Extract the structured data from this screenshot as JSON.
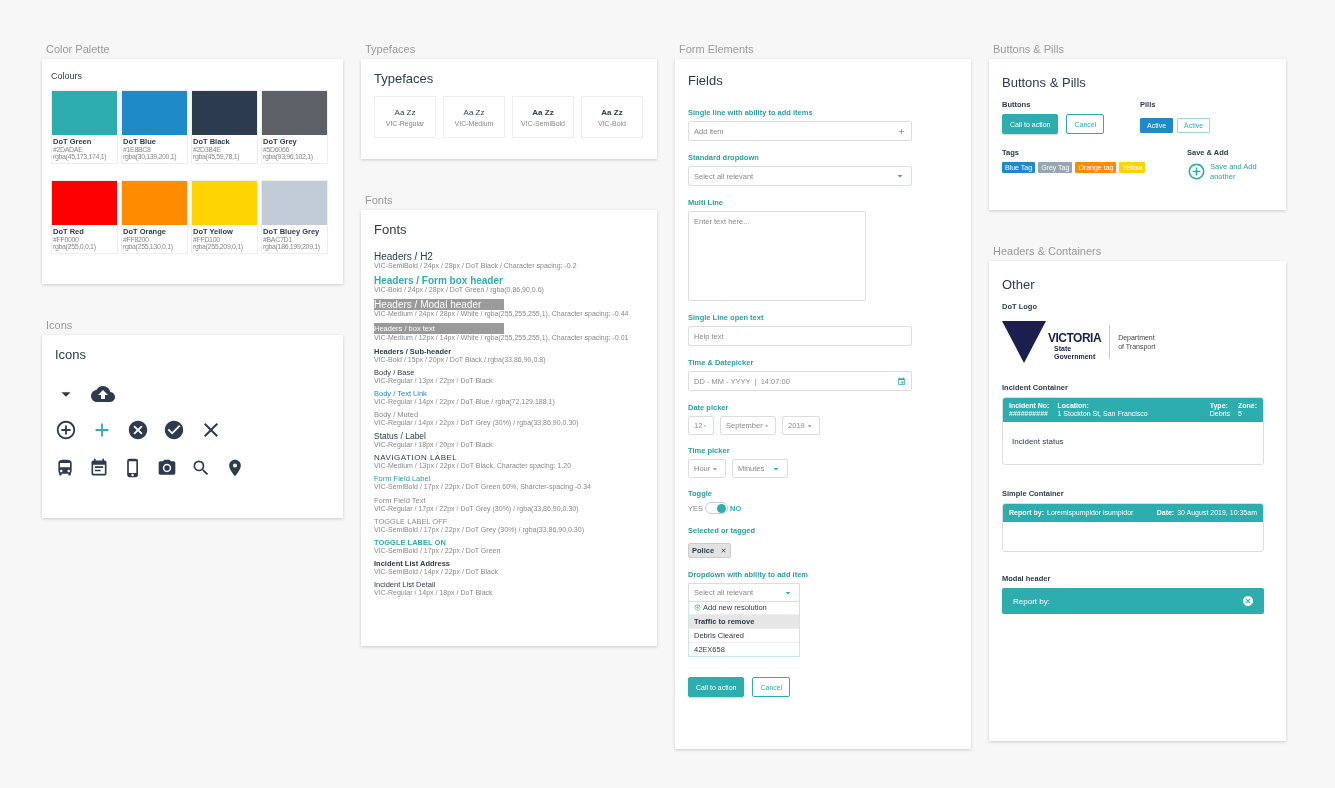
{
  "palette": {
    "section": "Color Palette",
    "title": "Colours",
    "swatches": [
      {
        "name": "DoT Green",
        "hex": "#2DADAE",
        "rgba": "rgba(45,173,174,1)",
        "color": "#2dadae"
      },
      {
        "name": "DoT Blue",
        "hex": "#1E8BC8",
        "rgba": "rgba(30,139,200,1)",
        "color": "#1e8bc8"
      },
      {
        "name": "DoT Black",
        "hex": "#2D3B4E",
        "rgba": "rgba(45,59,78,1)",
        "color": "#2d3b4e"
      },
      {
        "name": "DoT Grey",
        "hex": "#5D6066",
        "rgba": "rgba(93,96,102,1)",
        "color": "#5d6066"
      },
      {
        "name": "DoT Red",
        "hex": "#FF0000",
        "rgba": "rgba(255,0,0,1)",
        "color": "#ff0000"
      },
      {
        "name": "DoT Orange",
        "hex": "#FF8200",
        "rgba": "rgba(255,130,0,1)",
        "color": "#ff8b00"
      },
      {
        "name": "DoT Yellow",
        "hex": "#FFD100",
        "rgba": "rgba(255,209,0,1)",
        "color": "#ffd400"
      },
      {
        "name": "DoT Bluey Grey",
        "hex": "#BAC7D1",
        "rgba": "rgba(186,199,209,1)",
        "color": "#c1ccd6"
      }
    ]
  },
  "icons": {
    "section": "Icons",
    "title": "Icons"
  },
  "typefaces": {
    "section": "Typefaces",
    "title": "Typefaces",
    "samples": [
      {
        "sample": "Aa Zz",
        "name": "VIC-Regular",
        "kind": "regular"
      },
      {
        "sample": "Aa Zz",
        "name": "VIC-Medium",
        "kind": "medium"
      },
      {
        "sample": "Aa Zz",
        "name": "VIC-SemiBold",
        "kind": "semibold"
      },
      {
        "sample": "Aa Zz",
        "name": "VIC-Bold",
        "kind": "bold"
      }
    ]
  },
  "fonts": {
    "section": "Fonts",
    "title": "Fonts",
    "styles": [
      {
        "kind": "h2",
        "name": "Headers / H2",
        "spec": "VIC-SemiBold / 24px / 28px / DoT Black / Character spacing: -0.2"
      },
      {
        "kind": "form-header",
        "name": "Headers / Form box header",
        "spec": "VIC-Bold / 24px / 28px / DoT Green / rgba(0,86,90,0.6)"
      },
      {
        "kind": "modal-header",
        "name": "Headers / Modal header",
        "spec": "VIC-Medium / 24px / 28px / White / rgba(255,255,255,1), Character spacing: -0.44"
      },
      {
        "kind": "box-text",
        "name": "Headers / box text",
        "spec": "VIC-Medium / 12px / 14px / White / rgba(255,255,255,1), Character spacing: -0.01"
      },
      {
        "kind": "sub-header",
        "name": "Headers / Sub-header",
        "spec": "VIC-Bold / 15px / 20px / DoT Black / rgba(33,86,90,0.8)"
      },
      {
        "kind": "body",
        "name": "Body / Base",
        "spec": "VIC-Regular / 13px / 22px / DoT Black"
      },
      {
        "kind": "link",
        "name": "Body / Text Link",
        "spec": "VIC-Regular / 14px / 22px / DoT Blue / rgba(72,129,188,1)"
      },
      {
        "kind": "muted",
        "name": "Body / Muted",
        "spec": "VIC-Regular / 14px / 22px / DoT Grey (30%) / rgba(33,86,90,0.30)"
      },
      {
        "kind": "status",
        "name": "Status / Label",
        "spec": "VIC-Regular / 18px / 20px / DoT Black"
      },
      {
        "kind": "nav",
        "name": "NAVIGATION LABEL",
        "spec": "VIC-Medium / 13px / 22px / DoT Black, Character spacing: 1.20"
      },
      {
        "kind": "field-label",
        "name": "Form Field Label",
        "spec": "VIC-SemiBold / 17px / 22px / DoT Green 60%, Sharcter-spacing -0.34"
      },
      {
        "kind": "field-text",
        "name": "Form Field Text",
        "spec": "VIC-Regular / 17px / 22px / DoT Grey (30%) / rgba(33,86,90,0.30)"
      },
      {
        "kind": "toggle-off",
        "name": "TOGGLE LABEL OFF",
        "spec": "VIC-SemiBold / 17px / 22px / DoT Grey (30%) / rgba(33,86,90,0.30)"
      },
      {
        "kind": "toggle-on",
        "name": "TOGGLE LABEL ON",
        "spec": "VIC-SemiBold / 17px / 22px / DoT Green"
      },
      {
        "kind": "address",
        "name": "Incident List Address",
        "spec": "VIC-SemiBold / 14px / 22px / DoT Black"
      },
      {
        "kind": "detail",
        "name": "Incident List Detail",
        "spec": "VIC-Regular / 14px / 18px / DoT Black"
      }
    ]
  },
  "form": {
    "section": "Form Elements",
    "title": "Fields",
    "fields": [
      {
        "kind": "add",
        "label": "Single line with ability to add items",
        "placeholder": "Add item"
      },
      {
        "kind": "dropdown",
        "label": "Standard dropdown",
        "placeholder": "Select all relevant"
      },
      {
        "kind": "multiline",
        "label": "Multi Line",
        "placeholder": "Enter text here..."
      },
      {
        "kind": "text",
        "label": "Single Line open text",
        "placeholder": "Help text"
      },
      {
        "kind": "datetime",
        "label": "Time & Datepicker",
        "placeholder": "DD - MM - YYYY  |  14:07:00"
      },
      {
        "kind": "selects",
        "label": "Date picker",
        "selects": [
          "12",
          "September",
          "2019"
        ]
      },
      {
        "kind": "selects",
        "label": "Time picker",
        "selects": [
          "Hour",
          "Minutes"
        ]
      },
      {
        "kind": "toggle",
        "label": "Toggle",
        "off_label": "YES",
        "on_label": "NO",
        "on": true
      },
      {
        "kind": "tag",
        "label": "Selected or tagged",
        "tag": "Police"
      },
      {
        "kind": "dropdown-add",
        "label": "Dropdown with ability to add item",
        "placeholder": "Select all relevant",
        "add_label": "Add new resolution",
        "options": [
          {
            "label": "Traffic to remove",
            "selected": true
          },
          {
            "label": "Debris Cleared",
            "selected": false
          },
          {
            "label": "42EX658",
            "selected": false
          }
        ]
      }
    ],
    "buttons": [
      {
        "label": "Call to action",
        "kind": "primary"
      },
      {
        "label": "Cancel",
        "kind": "secondary"
      }
    ]
  },
  "buttons_pills": {
    "section": "Buttons & Pills",
    "title": "Buttons & Pills",
    "buttons_label": "Buttons",
    "buttons": [
      {
        "label": "Call to action",
        "kind": "primary"
      },
      {
        "label": "Cancel",
        "kind": "secondary"
      }
    ],
    "pills_label": "Pills",
    "pills": [
      {
        "label": "Active",
        "selected": true
      },
      {
        "label": "Active",
        "selected": false
      }
    ],
    "tags_label": "Tags",
    "tags": [
      {
        "label": "Blue Tag",
        "color": "#1e8bc8"
      },
      {
        "label": "Grey Tag",
        "color": "#98a6b3"
      },
      {
        "label": "Orange tag",
        "color": "#ff8b00"
      },
      {
        "label": "Yellow",
        "color": "#ffd400"
      }
    ],
    "save_label": "Save & Add",
    "save_text": "Save and Add another"
  },
  "containers": {
    "section": "Headers & Containers",
    "title": "Other",
    "logo_label": "DoT Logo",
    "logo": {
      "wordmark": "VICTORIA",
      "line1": "State",
      "line2": "Government",
      "dept1": "Department",
      "dept2": "of Transport"
    },
    "incident_label": "Incident Container",
    "incident_fields": [
      {
        "label": "Incident No:",
        "value": "##########"
      },
      {
        "label": "Location:",
        "value": "1 Stockton St, San Francisco"
      },
      {
        "label": "Type:",
        "value": "Debris"
      },
      {
        "label": "Zone:",
        "value": "5"
      }
    ],
    "incident_status": "Incident status",
    "simple_label": "Simple Container",
    "simple_fields": [
      {
        "label": "Report by:",
        "value": "Loremispumpidor isumpidor"
      },
      {
        "label": "Date:",
        "value": "30 August 2019, 10:35am"
      }
    ],
    "modal_label": "Modal header",
    "modal_title": "Report by:"
  }
}
